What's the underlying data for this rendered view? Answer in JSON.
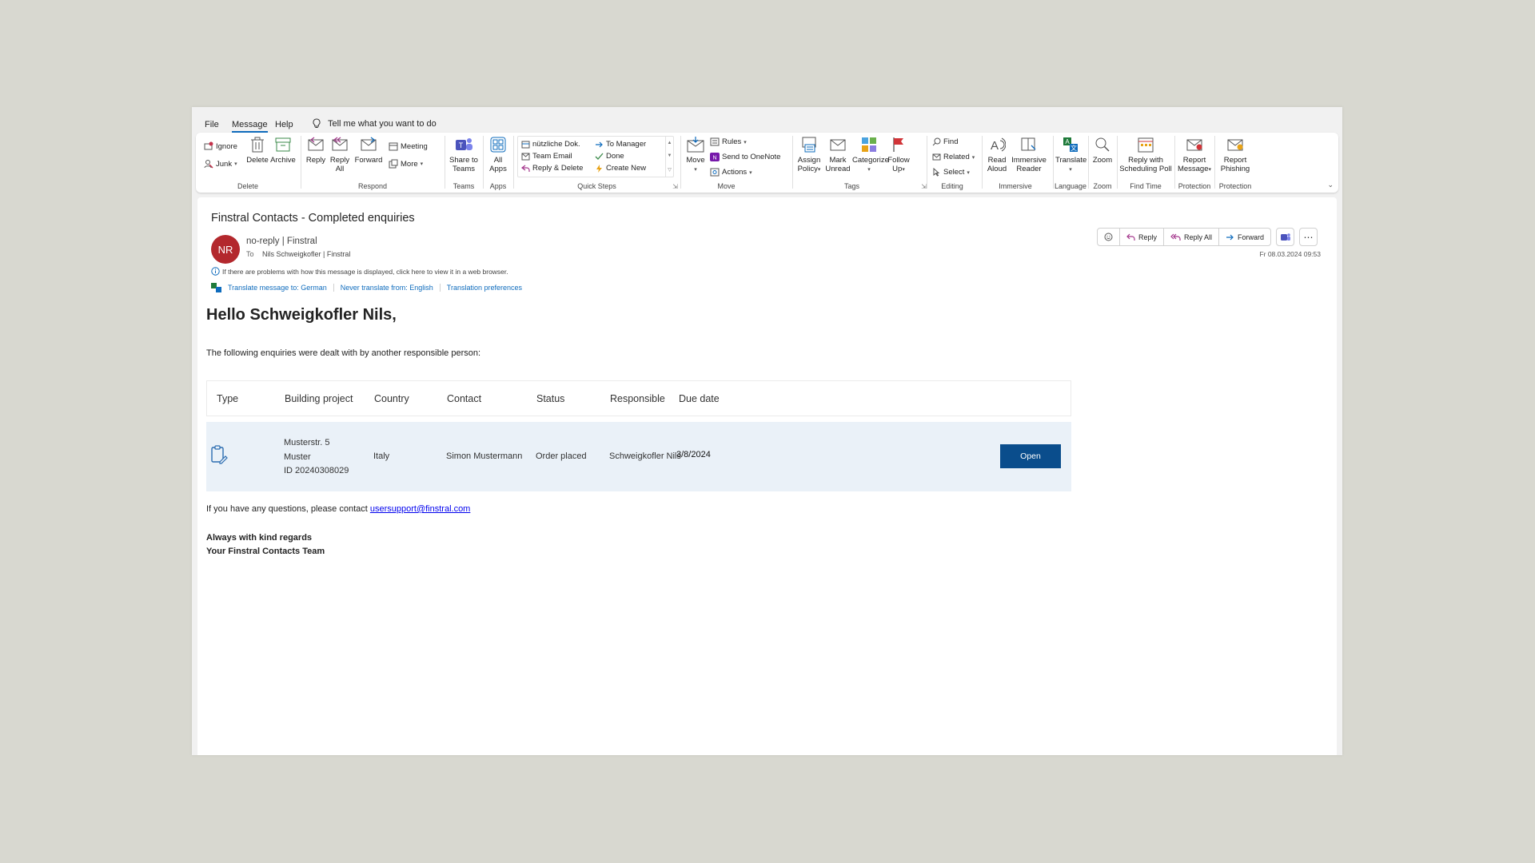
{
  "menubar": {
    "items": [
      "File",
      "Message",
      "Help"
    ],
    "tellme": "Tell me what you want to do"
  },
  "ribbon": {
    "delete": {
      "ignore": "Ignore",
      "junk": "Junk",
      "delete": "Delete",
      "archive": "Archive",
      "label": "Delete"
    },
    "respond": {
      "reply": "Reply",
      "reply_all_1": "Reply",
      "reply_all_2": "All",
      "forward": "Forward",
      "meeting": "Meeting",
      "more": "More",
      "label": "Respond"
    },
    "teams": {
      "share_1": "Share to",
      "share_2": "Teams",
      "label": "Teams"
    },
    "apps": {
      "all_1": "All",
      "all_2": "Apps",
      "label": "Apps"
    },
    "quicksteps": {
      "items": [
        "nützliche Dok.",
        "Team Email",
        "Reply & Delete",
        "To Manager",
        "Done",
        "Create New"
      ],
      "label": "Quick Steps"
    },
    "move": {
      "move": "Move",
      "rules": "Rules",
      "onenote": "Send to OneNote",
      "actions": "Actions",
      "label": "Move"
    },
    "tags": {
      "assign_1": "Assign",
      "assign_2": "Policy",
      "mark_1": "Mark",
      "mark_2": "Unread",
      "categorize": "Categorize",
      "follow_1": "Follow",
      "follow_2": "Up",
      "label": "Tags"
    },
    "editing": {
      "find": "Find",
      "related": "Related",
      "select": "Select",
      "label": "Editing"
    },
    "immersive": {
      "read_1": "Read",
      "read_2": "Aloud",
      "imm_1": "Immersive",
      "imm_2": "Reader",
      "label": "Immersive"
    },
    "language": {
      "translate": "Translate",
      "label": "Language"
    },
    "zoom": {
      "zoom": "Zoom",
      "label": "Zoom"
    },
    "findtime": {
      "reply_1": "Reply with",
      "reply_2": "Scheduling Poll",
      "label": "Find Time"
    },
    "protection1": {
      "report_1": "Report",
      "report_2": "Message",
      "label": "Protection"
    },
    "protection2": {
      "report_1": "Report",
      "report_2": "Phishing",
      "label": "Protection"
    }
  },
  "message": {
    "subject": "Finstral Contacts - Completed enquiries",
    "avatar_initials": "NR",
    "avatar_color": "#b3282d",
    "sender": "no-reply | Finstral",
    "to_label": "To",
    "to": "Nils Schweigkofler | Finstral",
    "info": "If there are problems with how this message is displayed, click here to view it in a web browser.",
    "translate_links": [
      "Translate message to: German",
      "Never translate from: English",
      "Translation preferences"
    ],
    "actions": {
      "reply": "Reply",
      "reply_all": "Reply All",
      "forward": "Forward"
    },
    "date": "Fr 08.03.2024 09:53"
  },
  "body": {
    "greeting": "Hello Schweigkofler Nils,",
    "intro": "The following enquiries were dealt with by another responsible person:",
    "table": {
      "headers": [
        "Type",
        "Building project",
        "Country",
        "Contact",
        "Status",
        "Responsible",
        "Due date"
      ],
      "rows": [
        {
          "project_lines": [
            "Musterstr. 5",
            "Muster",
            "ID 20240308029"
          ],
          "country": "Italy",
          "contact": "Simon Mustermann",
          "status": "Order placed",
          "responsible": "Schweigkofler Nils",
          "due_date": "3/8/2024",
          "button": "Open"
        }
      ]
    },
    "contact_prefix": "If you have any questions, please contact ",
    "contact_email": "usersupport@finstral.com",
    "regards_1": "Always with kind regards",
    "regards_2": "Your Finstral Contacts Team"
  },
  "colors": {
    "accent": "#0f6cbd",
    "open_button": "#0a4d8c",
    "row_bg": "#eaf1f8"
  }
}
